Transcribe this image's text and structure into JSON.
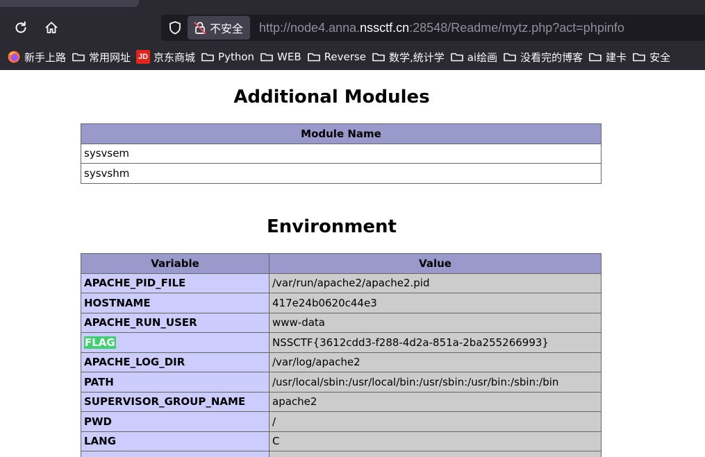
{
  "browser": {
    "url_prefix": "http://node4.anna.",
    "url_host": "nssctf.cn",
    "url_suffix": ":28548/Readme/mytz.php?act=phpinfo",
    "security_label": "不安全",
    "bookmarks": [
      {
        "label": "新手上路",
        "icon": "firefox-icon"
      },
      {
        "label": "常用网址",
        "icon": "folder-icon"
      },
      {
        "label": "京东商城",
        "icon": "jd-icon",
        "badge": "JD"
      },
      {
        "label": "Python",
        "icon": "folder-icon"
      },
      {
        "label": "WEB",
        "icon": "folder-icon"
      },
      {
        "label": "Reverse",
        "icon": "folder-icon"
      },
      {
        "label": "数学,统计学",
        "icon": "folder-icon"
      },
      {
        "label": "ai绘画",
        "icon": "folder-icon"
      },
      {
        "label": "没看完的博客",
        "icon": "folder-icon"
      },
      {
        "label": "建卡",
        "icon": "folder-icon"
      },
      {
        "label": "安全",
        "icon": "folder-icon"
      }
    ]
  },
  "modules": {
    "title": "Additional Modules",
    "header": "Module Name",
    "rows": [
      "sysvsem",
      "sysvshm"
    ]
  },
  "environment": {
    "title": "Environment",
    "header_variable": "Variable",
    "header_value": "Value",
    "rows": [
      {
        "name": "APACHE_PID_FILE",
        "value": "/var/run/apache2/apache2.pid"
      },
      {
        "name": "HOSTNAME",
        "value": "417e24b0620c44e3"
      },
      {
        "name": "APACHE_RUN_USER",
        "value": "www-data"
      },
      {
        "name": "FLAG",
        "value": "NSSCTF{3612cdd3-f288-4d2a-851a-2ba255266993}"
      },
      {
        "name": "APACHE_LOG_DIR",
        "value": "/var/log/apache2"
      },
      {
        "name": "PATH",
        "value": "/usr/local/sbin:/usr/local/bin:/usr/sbin:/usr/bin:/sbin:/bin"
      },
      {
        "name": "SUPERVISOR_GROUP_NAME",
        "value": "apache2"
      },
      {
        "name": "PWD",
        "value": "/"
      },
      {
        "name": "LANG",
        "value": "C"
      },
      {
        "name": "",
        "value": ""
      }
    ]
  },
  "colors": {
    "chrome_bg": "#2b2a33",
    "urlbar_bg": "#1c1b22",
    "table_header": "#9999cc",
    "key_cell": "#ccccff",
    "value_cell": "#cccccc",
    "flag_highlight": "#3fd06f"
  }
}
